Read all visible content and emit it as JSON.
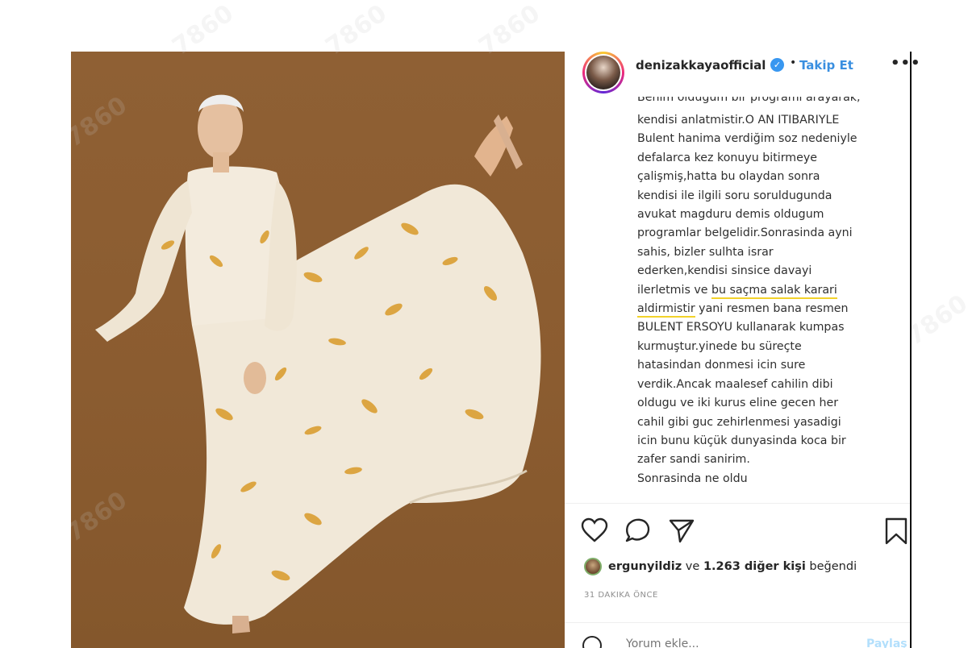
{
  "post": {
    "username": "denizakkayaofficial",
    "follow_label": "Takip Et",
    "more_label": "•••",
    "separator": "•",
    "verified_icon": "verified-badge-icon",
    "caption_lines": [
      "Benim oldugum bir programi arayarak,",
      "kendisi anlatmistir.O AN ITIBARIYLE",
      "Bulent hanima verdiğim soz nedeniyle",
      "defalarca kez konuyu bitirmeye",
      "çalişmiş,hatta bu olaydan sonra",
      "kendisi ile ilgili soru soruldugunda",
      "avukat magduru demis oldugum",
      "programlar belgelidir.Sonrasinda ayni",
      "sahis, bizler sulhta israr",
      "ederken,kendisi sinsice davayi"
    ],
    "caption_line_10_pre": "ilerletmis ve ",
    "caption_line_10_hl": "bu saçma salak karari",
    "caption_line_11_hl": "aldirmistir",
    "caption_line_11_post": " yani resmen bana resmen",
    "caption_lines_after": [
      "BULENT ERSOYU kullanarak kumpas",
      "kurmuştur.yinede bu süreçte",
      "hatasindan donmesi icin sure",
      "verdik.Ancak maalesef cahilin dibi",
      "oldugu ve iki kurus eline gecen her",
      "cahil gibi guc zehirlenmesi yasadigi",
      "icin bunu küçük dunyasinda koca bir",
      "zafer sandi sanirim.",
      "Sonrasinda ne oldu"
    ],
    "likes": {
      "user": "ergunyildiz",
      "middle": " ve ",
      "count": "1.263 diğer kişi",
      "suffix": " beğendi"
    },
    "time": "31 DAKIKA ÖNCE",
    "comment_placeholder": "Yorum ekle...",
    "post_label": "Paylaş",
    "icons": [
      "heart-icon",
      "comment-icon",
      "share-icon",
      "bookmark-icon",
      "emoji-icon"
    ]
  },
  "watermark_text": "7860"
}
